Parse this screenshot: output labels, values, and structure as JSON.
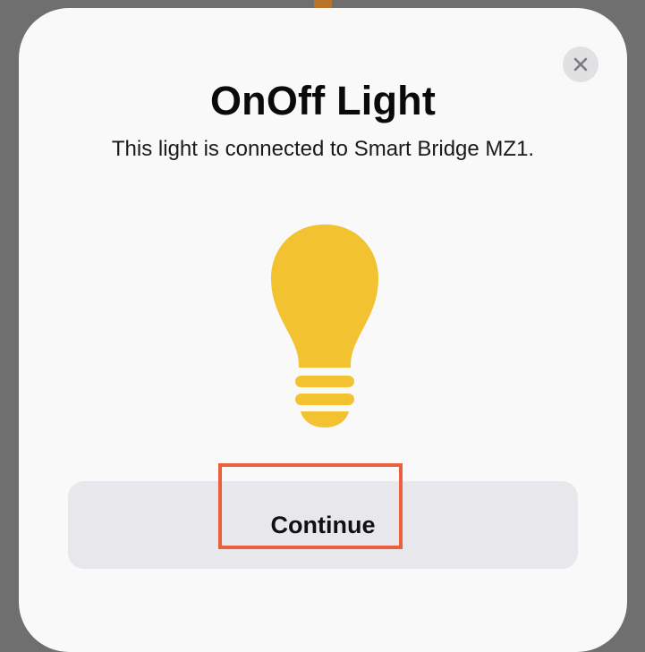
{
  "dialog": {
    "title": "OnOff Light",
    "subtitle": "This light is connected to Smart Bridge MZ1.",
    "close_icon": "close-icon",
    "accessory_icon": "lightbulb-icon",
    "bulb_color": "#f2c230",
    "continue_label": "Continue"
  },
  "annotation": {
    "highlight_color": "#e8603c"
  }
}
